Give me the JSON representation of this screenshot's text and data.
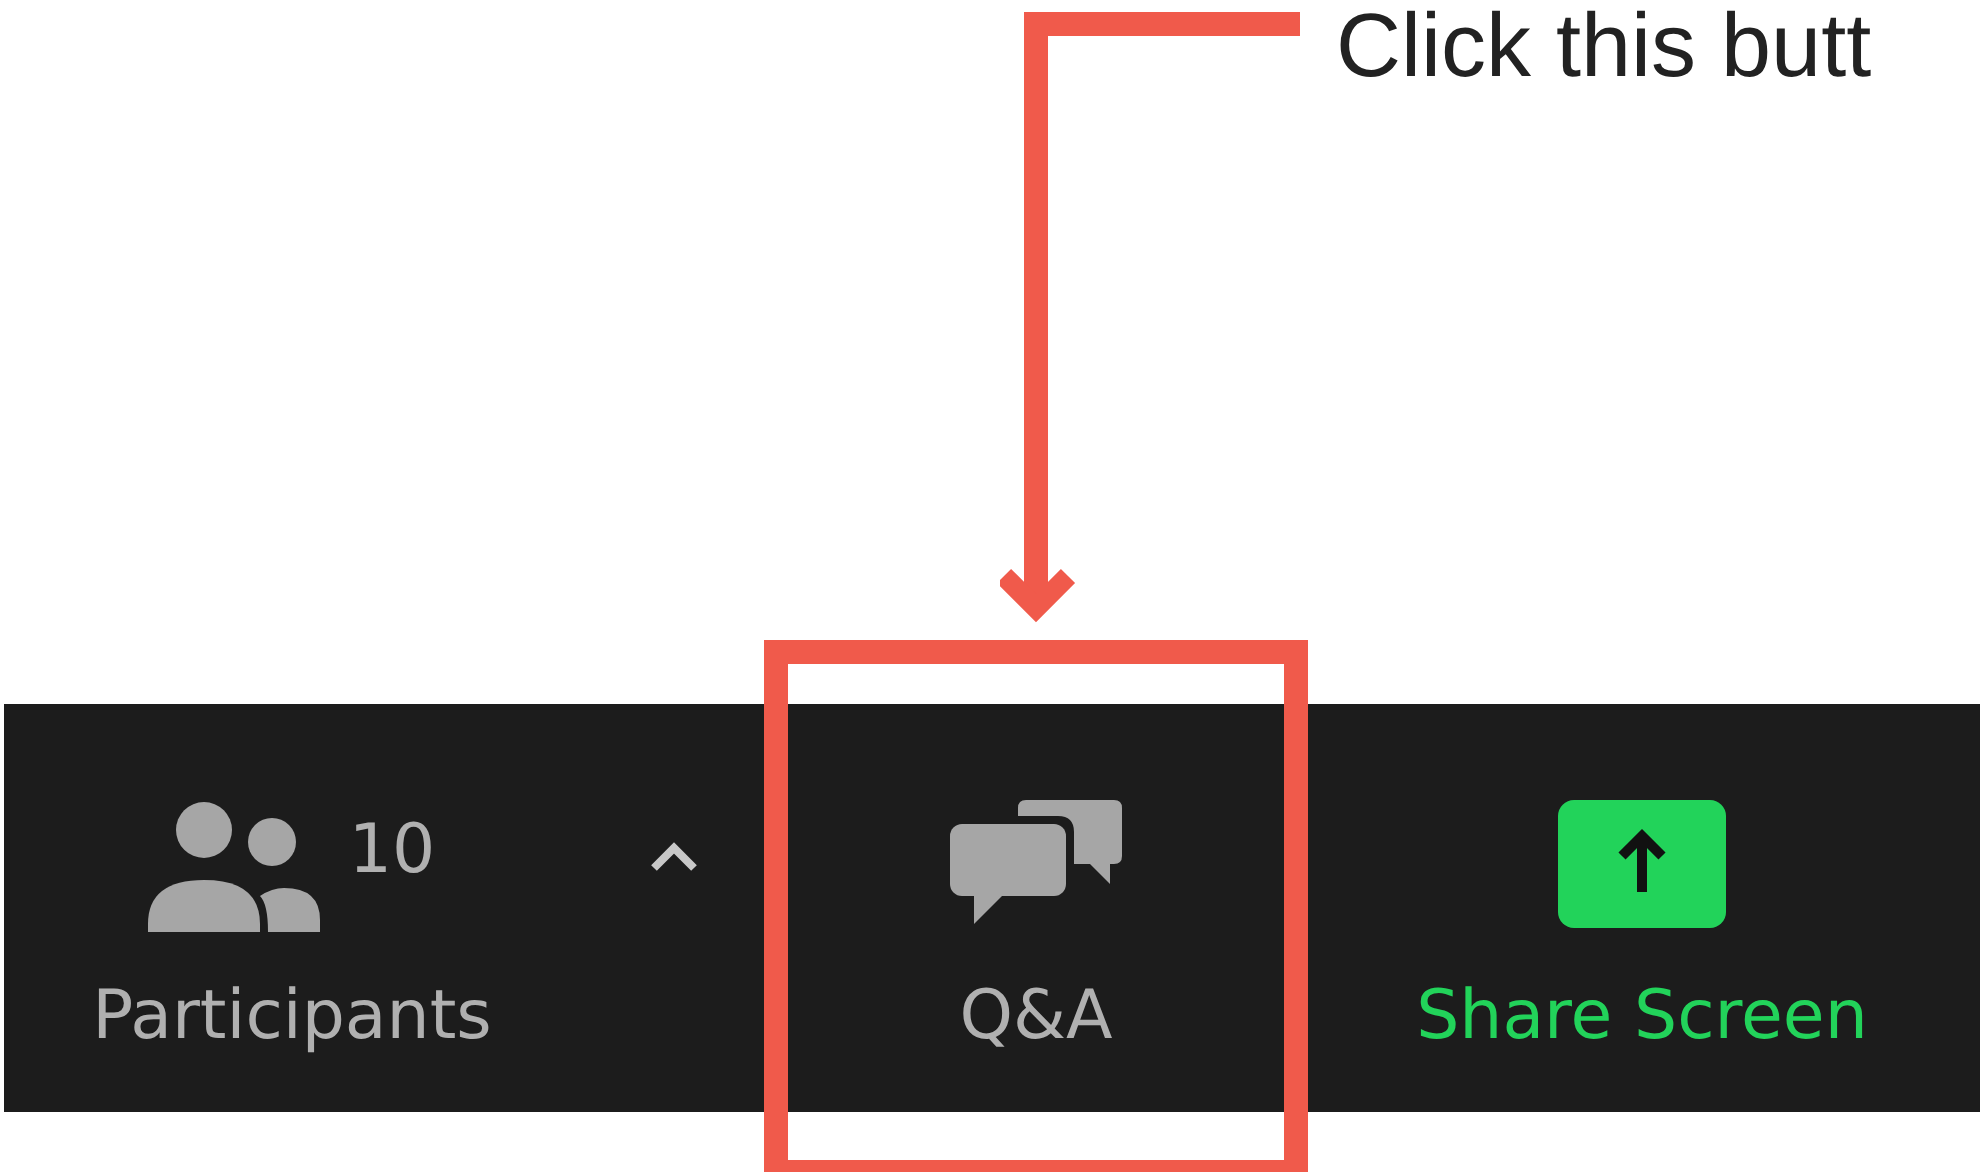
{
  "annotation": {
    "text": "Click this butt"
  },
  "toolbar": {
    "items": [
      {
        "kind": "participants",
        "label": "Participants",
        "count": "10",
        "highlighted": false
      },
      {
        "kind": "caret",
        "highlighted": false
      },
      {
        "kind": "qa",
        "label": "Q&A",
        "highlighted": true
      },
      {
        "kind": "share",
        "label": "Share Screen",
        "highlighted": false
      }
    ]
  }
}
